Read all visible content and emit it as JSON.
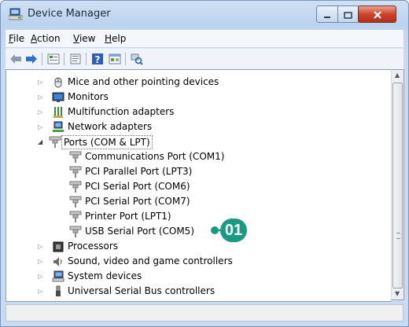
{
  "window": {
    "title": "Device Manager"
  },
  "menubar": {
    "items": [
      {
        "label": "File",
        "accel": "F",
        "rest": "ile"
      },
      {
        "label": "Action",
        "accel": "A",
        "rest": "ction"
      },
      {
        "label": "View",
        "accel": "V",
        "rest": "iew"
      },
      {
        "label": "Help",
        "accel": "H",
        "rest": "elp"
      }
    ]
  },
  "toolbar": {
    "buttons": [
      "back-icon",
      "forward-icon",
      "properties-icon",
      "update-driver-icon",
      "help-icon",
      "show-hidden-icon",
      "scan-hardware-icon"
    ]
  },
  "tree": {
    "items": [
      {
        "label": "Mice and other pointing devices",
        "icon": "mouse-icon"
      },
      {
        "label": "Monitors",
        "icon": "monitor-icon"
      },
      {
        "label": "Multifunction adapters",
        "icon": "multifunction-adapter-icon"
      },
      {
        "label": "Network adapters",
        "icon": "network-adapter-icon"
      },
      {
        "label": "Ports (COM & LPT)",
        "icon": "port-icon"
      },
      {
        "label": "Communications Port (COM1)",
        "icon": "port-icon"
      },
      {
        "label": "PCI Parallel Port (LPT3)",
        "icon": "port-icon"
      },
      {
        "label": "PCI Serial Port (COM6)",
        "icon": "port-icon"
      },
      {
        "label": "PCI Serial Port (COM7)",
        "icon": "port-icon"
      },
      {
        "label": "Printer Port (LPT1)",
        "icon": "port-icon"
      },
      {
        "label": "USB Serial Port (COM5)",
        "icon": "port-icon"
      },
      {
        "label": "Processors",
        "icon": "processor-icon"
      },
      {
        "label": "Sound, video and game controllers",
        "icon": "sound-icon"
      },
      {
        "label": "System devices",
        "icon": "system-device-icon"
      },
      {
        "label": "Universal Serial Bus controllers",
        "icon": "usb-icon"
      }
    ]
  },
  "callout": {
    "label": "01",
    "color": "#1a9a82"
  }
}
